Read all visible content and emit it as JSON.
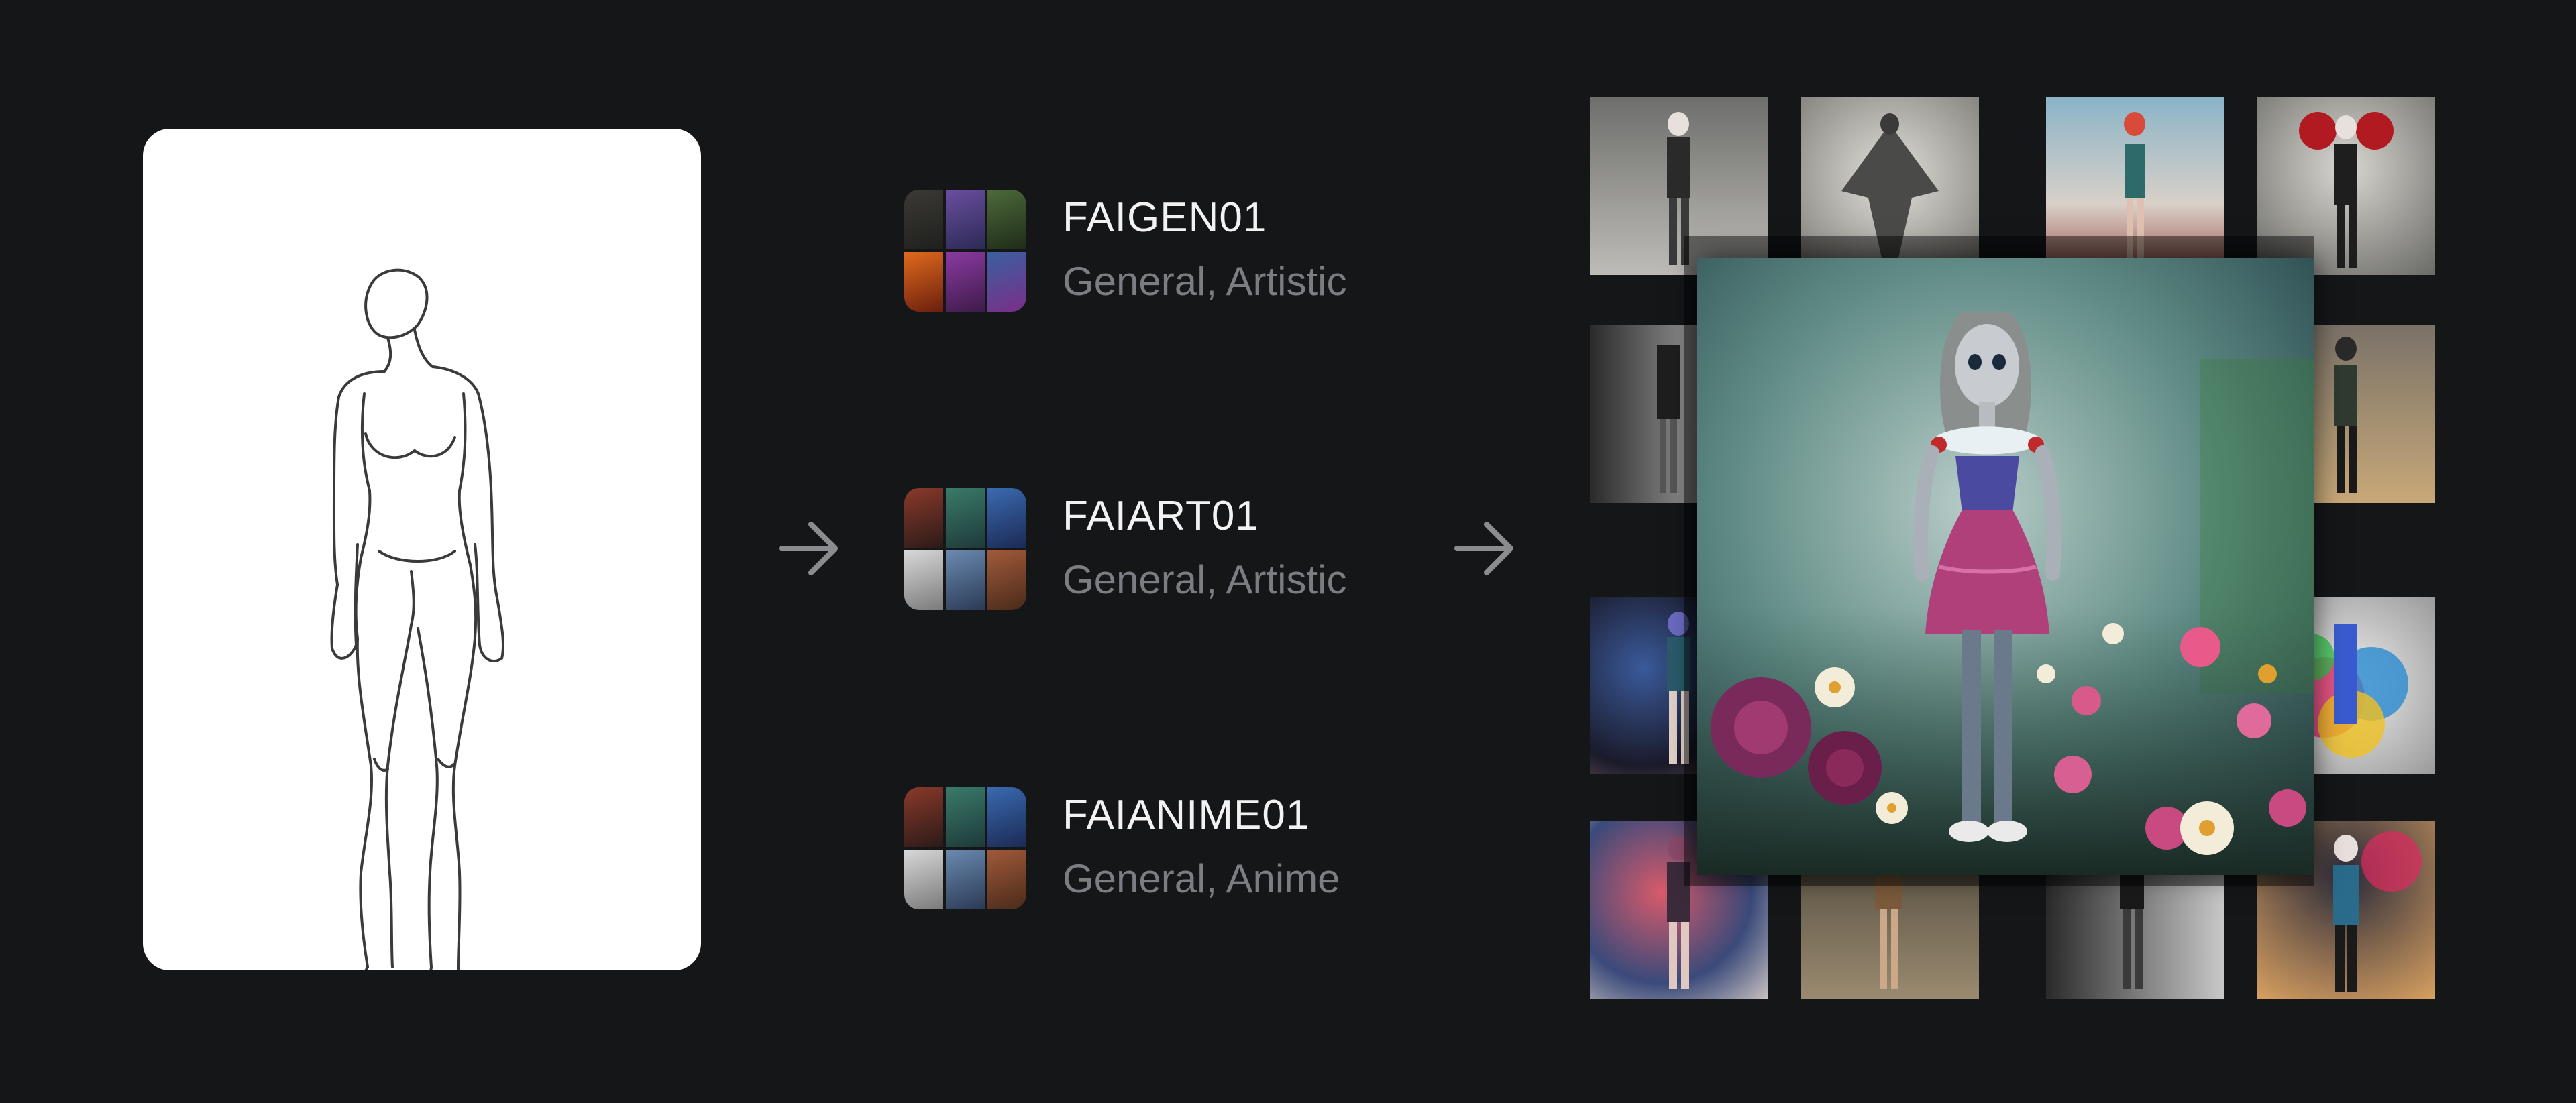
{
  "models": [
    {
      "name": "FAIGEN01",
      "tags": "General, Artistic"
    },
    {
      "name": "FAIART01",
      "tags": "General, Artistic"
    },
    {
      "name": "FAIANIME01",
      "tags": "General, Anime"
    }
  ],
  "icons": {
    "arrow": "arrow-right-icon",
    "sketch": "figure-sketch-icon"
  },
  "colors": {
    "background": "#151618",
    "card": "#ffffff",
    "model_name": "#f2f2f2",
    "model_tags": "#7b7d82",
    "arrow": "#8a8c90"
  }
}
